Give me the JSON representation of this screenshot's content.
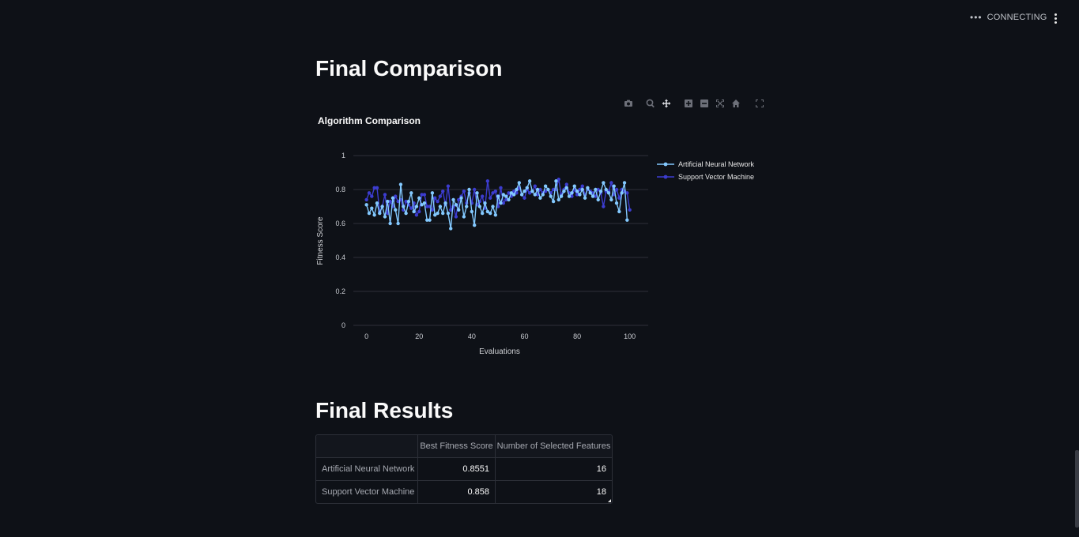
{
  "header": {
    "status_text": "CONNECTING",
    "status_icon": "ellipsis-icon",
    "menu_icon": "vertical-dots-icon"
  },
  "sections": {
    "comparison_title": "Final Comparison",
    "results_title": "Final Results"
  },
  "modebar": [
    "camera-icon",
    "zoom-icon",
    "pan-icon",
    "zoom-in-icon",
    "zoom-out-icon",
    "autoscale-icon",
    "home-icon",
    "fullscreen-icon"
  ],
  "colors": {
    "background": "#0e1117",
    "ann": "#83c9ff",
    "svm": "#3c3ccf",
    "grid": "#2d3039"
  },
  "chart_data": {
    "type": "line",
    "title": "Algorithm Comparison",
    "xlabel": "Evaluations",
    "ylabel": "Fitness Score",
    "xlim": [
      -5,
      107
    ],
    "ylim": [
      0,
      1
    ],
    "x_ticks": [
      0,
      20,
      40,
      60,
      80,
      100
    ],
    "y_ticks": [
      0,
      0.2,
      0.4,
      0.6,
      0.8,
      1
    ],
    "x_tick_labels": [
      "0",
      "20",
      "40",
      "60",
      "80",
      "100"
    ],
    "y_tick_labels": [
      "0",
      "0.2",
      "0.4",
      "0.6",
      "0.8",
      "1"
    ],
    "legend_position": "top-right",
    "series": [
      {
        "name": "Artificial Neural Network",
        "color": "#83c9ff",
        "values": [
          0.71,
          0.66,
          0.69,
          0.65,
          0.72,
          0.66,
          0.7,
          0.64,
          0.73,
          0.6,
          0.75,
          0.68,
          0.6,
          0.83,
          0.7,
          0.66,
          0.73,
          0.78,
          0.67,
          0.7,
          0.75,
          0.71,
          0.72,
          0.62,
          0.62,
          0.78,
          0.65,
          0.66,
          0.7,
          0.66,
          0.72,
          0.66,
          0.57,
          0.74,
          0.71,
          0.68,
          0.75,
          0.64,
          0.7,
          0.8,
          0.67,
          0.59,
          0.78,
          0.7,
          0.66,
          0.72,
          0.67,
          0.66,
          0.7,
          0.65,
          0.76,
          0.72,
          0.77,
          0.76,
          0.74,
          0.78,
          0.77,
          0.8,
          0.84,
          0.77,
          0.79,
          0.81,
          0.85,
          0.79,
          0.77,
          0.8,
          0.75,
          0.77,
          0.82,
          0.8,
          0.76,
          0.73,
          0.85,
          0.74,
          0.76,
          0.79,
          0.81,
          0.76,
          0.78,
          0.82,
          0.79,
          0.77,
          0.8,
          0.75,
          0.81,
          0.78,
          0.76,
          0.8,
          0.74,
          0.79,
          0.84,
          0.8,
          0.78,
          0.74,
          0.82,
          0.72,
          0.67,
          0.78,
          0.84,
          0.62
        ]
      },
      {
        "name": "Support Vector Machine",
        "color": "#3c3ccf",
        "values": [
          0.74,
          0.78,
          0.76,
          0.81,
          0.81,
          0.67,
          0.7,
          0.77,
          0.66,
          0.73,
          0.7,
          0.76,
          0.73,
          0.74,
          0.68,
          0.73,
          0.71,
          0.69,
          0.72,
          0.65,
          0.67,
          0.77,
          0.77,
          0.7,
          0.7,
          0.68,
          0.75,
          0.73,
          0.76,
          0.79,
          0.71,
          0.82,
          0.68,
          0.7,
          0.64,
          0.74,
          0.76,
          0.79,
          0.72,
          0.78,
          0.72,
          0.8,
          0.71,
          0.73,
          0.76,
          0.69,
          0.85,
          0.75,
          0.78,
          0.79,
          0.7,
          0.81,
          0.72,
          0.74,
          0.78,
          0.76,
          0.79,
          0.78,
          0.81,
          0.77,
          0.75,
          0.8,
          0.78,
          0.79,
          0.82,
          0.77,
          0.8,
          0.78,
          0.79,
          0.8,
          0.78,
          0.8,
          0.8,
          0.86,
          0.77,
          0.8,
          0.83,
          0.78,
          0.76,
          0.8,
          0.77,
          0.8,
          0.82,
          0.77,
          0.8,
          0.79,
          0.78,
          0.76,
          0.8,
          0.78,
          0.7,
          0.79,
          0.79,
          0.84,
          0.77,
          0.8,
          0.75,
          0.8,
          0.79,
          0.78,
          0.68
        ]
      }
    ]
  },
  "table": {
    "columns": [
      "",
      "Best Fitness Score",
      "Number of Selected Features"
    ],
    "rows": [
      {
        "label": "Artificial Neural Network",
        "score": "0.8551",
        "features": "16"
      },
      {
        "label": "Support Vector Machine",
        "score": "0.858",
        "features": "18"
      }
    ]
  }
}
